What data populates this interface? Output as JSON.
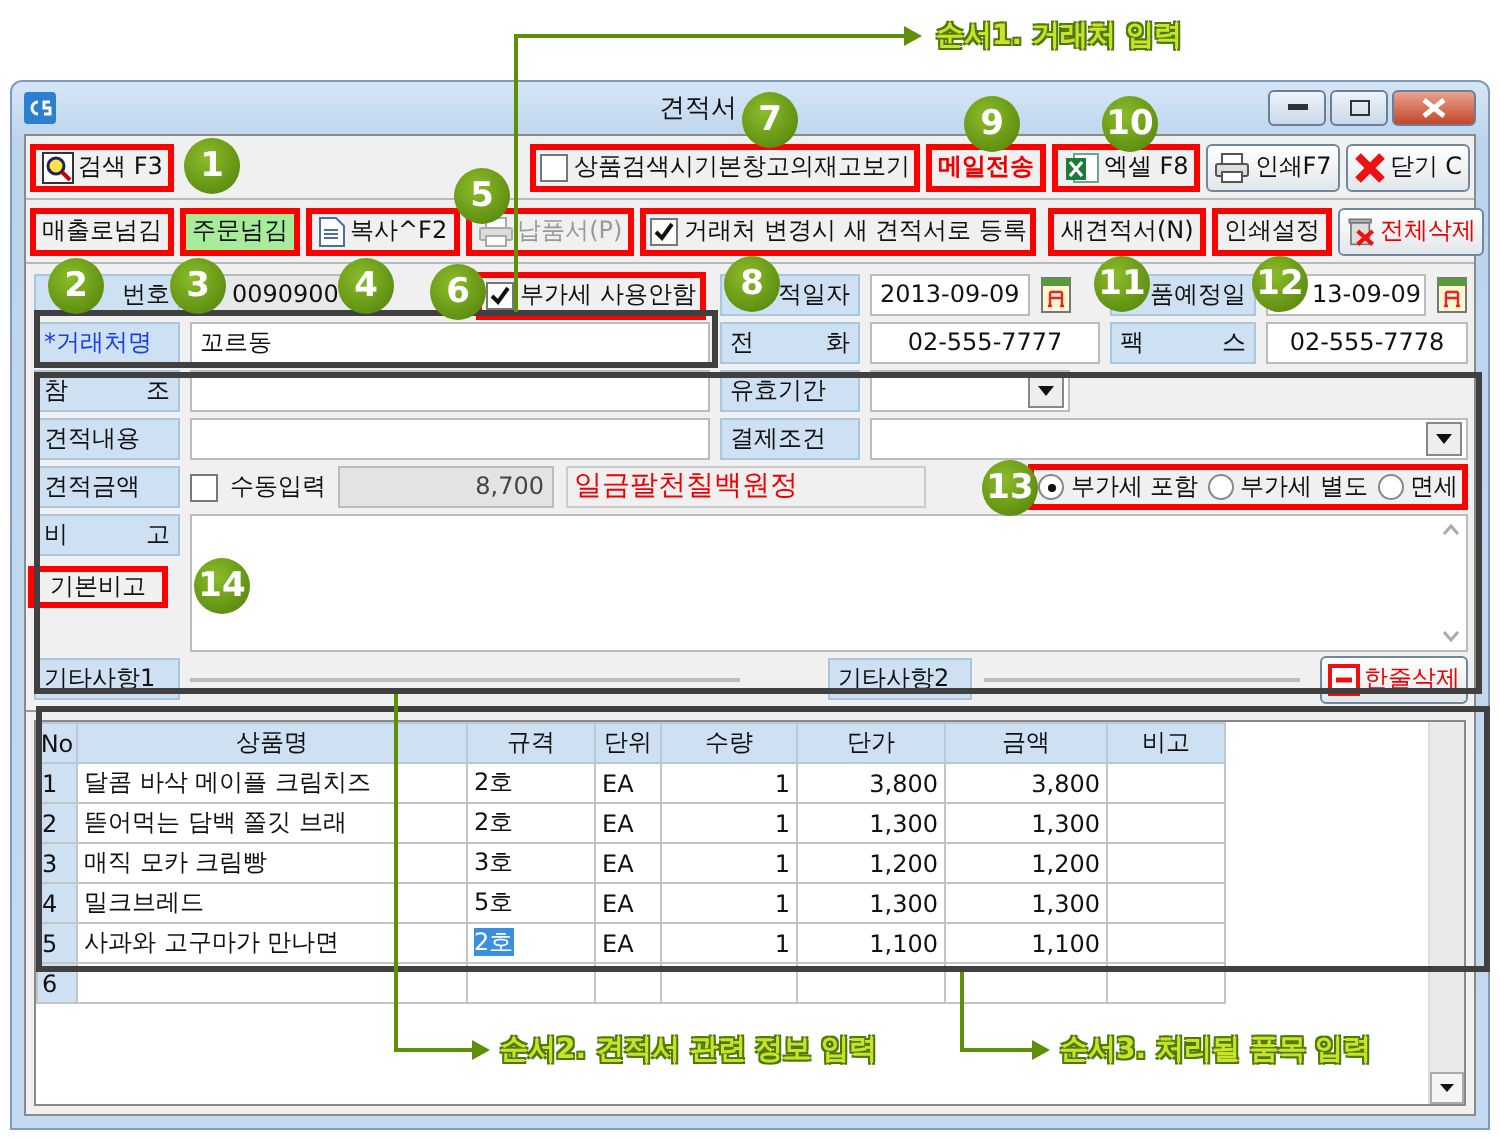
{
  "window": {
    "title": "견적서"
  },
  "toolbar_top": {
    "left": [
      {
        "label": "검색 F3",
        "kind": "search",
        "boxed": true
      }
    ],
    "option": {
      "label": "상품검색시기본창고의재고보기",
      "checked": false,
      "boxed": true
    },
    "right": [
      {
        "label": "메일전송",
        "kind": "mail",
        "boxed": true
      },
      {
        "label": "엑셀 F8",
        "kind": "excel",
        "boxed": true
      },
      {
        "label": "인쇄F7",
        "kind": "print",
        "boxed": false
      },
      {
        "label": "닫기 C",
        "kind": "close",
        "boxed": false
      }
    ]
  },
  "toolbar_second": {
    "left": [
      {
        "label": "매출로넘김",
        "kind": "plain",
        "boxed": true,
        "disabled": false
      },
      {
        "label": "주문넘김",
        "kind": "green",
        "boxed": true,
        "disabled": false
      },
      {
        "label": "복사^F2",
        "kind": "copy",
        "boxed": true,
        "disabled": false
      },
      {
        "label": "납품서(P)",
        "kind": "printdoc",
        "boxed": true,
        "disabled": true
      }
    ],
    "option": {
      "label": "거래처 변경시 새 견적서로 등록",
      "checked": true,
      "boxed": true
    },
    "right": [
      {
        "label": "새견적서(N)",
        "kind": "plain",
        "boxed": true,
        "disabled": false
      },
      {
        "label": "인쇄설정",
        "kind": "plain",
        "boxed": true,
        "disabled": false
      },
      {
        "label": "전체삭제",
        "kind": "trash",
        "boxed": false,
        "disabled": false
      }
    ]
  },
  "form": {
    "quote_no": {
      "label": "번호",
      "value": "0090900"
    },
    "vat_off": {
      "label": "부가세 사용안함",
      "checked": true,
      "boxed": true
    },
    "quote_date": {
      "label": "적일자",
      "value": "2013-09-09"
    },
    "delivery_date": {
      "label": "품예정일",
      "value": "13-09-09"
    },
    "client": {
      "label": "*거래처명",
      "value": "꼬르동"
    },
    "phone": {
      "label": "전 화",
      "value": "02-555-7777"
    },
    "fax": {
      "label": "팩 스",
      "value": "02-555-7778"
    },
    "reference": {
      "label": "참 조"
    },
    "validity": {
      "label": "유효기간"
    },
    "content": {
      "label": "견적내용"
    },
    "payment": {
      "label": "결제조건"
    },
    "amount": {
      "label": "견적금액",
      "manual": {
        "label": "수동입력",
        "checked": false
      },
      "value": "8,700",
      "in_words": "일금팔천칠백원정"
    },
    "vat_options": {
      "boxed": true,
      "options": [
        {
          "label": "부가세 포함",
          "selected": true
        },
        {
          "label": "부가세 별도",
          "selected": false
        },
        {
          "label": "면세",
          "selected": false
        }
      ]
    },
    "note": {
      "label": "비 고",
      "default_button": {
        "label": "기본비고",
        "boxed": true
      }
    },
    "etc1": {
      "label": "기타사항1"
    },
    "etc2": {
      "label": "기타사항2"
    },
    "delete_row": {
      "label": "한줄삭제"
    }
  },
  "table": {
    "columns": [
      "No",
      "상품명",
      "규격",
      "단위",
      "수량",
      "단가",
      "금액",
      "비고"
    ],
    "rows": [
      {
        "cells": [
          "1",
          "달콤 바삭 메이플 크림치즈",
          "2호",
          "EA",
          "1",
          "3,800",
          "3,800"
        ],
        "spec_selected": false
      },
      {
        "cells": [
          "2",
          "뜯어먹는 담백 쫄깃 브래",
          "2호",
          "EA",
          "1",
          "1,300",
          "1,300"
        ],
        "spec_selected": false
      },
      {
        "cells": [
          "3",
          "매직 모카 크림빵",
          "3호",
          "EA",
          "1",
          "1,200",
          "1,200"
        ],
        "spec_selected": false
      },
      {
        "cells": [
          "4",
          "밀크브레드",
          "5호",
          "EA",
          "1",
          "1,300",
          "1,300"
        ],
        "spec_selected": false
      },
      {
        "cells": [
          "5",
          "사과와 고구마가 만나면",
          "2호",
          "EA",
          "1",
          "1,100",
          "1,100"
        ],
        "spec_selected": true
      },
      {
        "cells": [
          "6"
        ],
        "spec_selected": false
      }
    ]
  },
  "annotations": {
    "markers": [
      "1",
      "2",
      "3",
      "4",
      "5",
      "6",
      "7",
      "8",
      "9",
      "10",
      "11",
      "12",
      "13",
      "14"
    ],
    "steps": [
      "순서1. 거래처 입력",
      "순서2. 견적서 관련 정보 입력",
      "순서3. 처리될 품목 입력"
    ]
  }
}
